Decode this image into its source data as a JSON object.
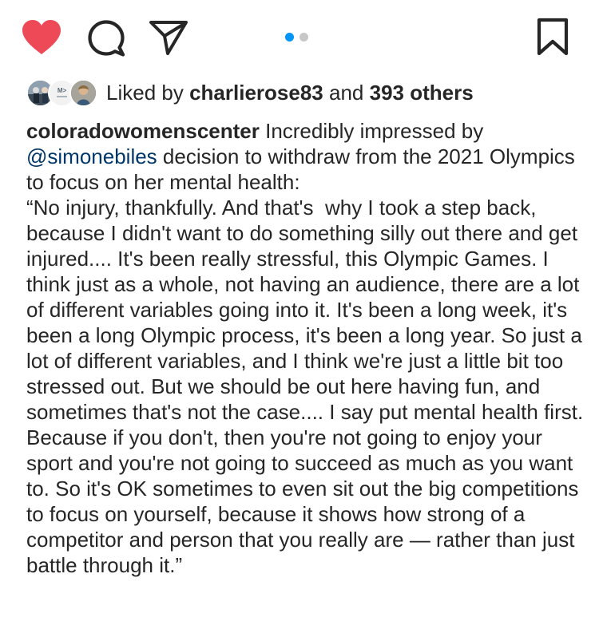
{
  "actions": {
    "like_icon": "heart-filled-icon",
    "comment_icon": "comment-icon",
    "share_icon": "paper-plane-icon",
    "save_icon": "bookmark-icon",
    "like_color": "#ed4956"
  },
  "carousel": {
    "active_color": "#0095f6",
    "inactive_color": "#c7c7c7",
    "active_index": 1,
    "total": 2
  },
  "likes": {
    "prefix": "Liked by",
    "user": "charlierose83",
    "connector": "and",
    "others": "393 others"
  },
  "caption": {
    "username": "coloradowomenscenter",
    "intro_before_mention": "Incredibly impressed by",
    "mention": "@simonebiles",
    "intro_after_mention": "decision to withdraw from the 2021 Olympics to focus on her mental health:",
    "quote": "“No injury, thankfully. And that's  why I took a step back, because I didn't want to do something silly out there and get injured.... It's been really stressful, this Olympic Games. I think just as a whole, not having an audience, there are a lot of different variables going into it. It's been a long week, it's been a long Olympic process, it's been a long year. So just a lot of different variables, and I think we're just a little bit too stressed out. But we should be out here having fun, and sometimes that's not the case.... I say put mental health first. Because if you don't, then you're not going to enjoy your sport and you're not going to succeed as much as you want to. So it's OK sometimes to even sit out the big competitions to focus on yourself, because it shows how strong of a competitor and person that you really are — rather than just battle through it.”"
  }
}
